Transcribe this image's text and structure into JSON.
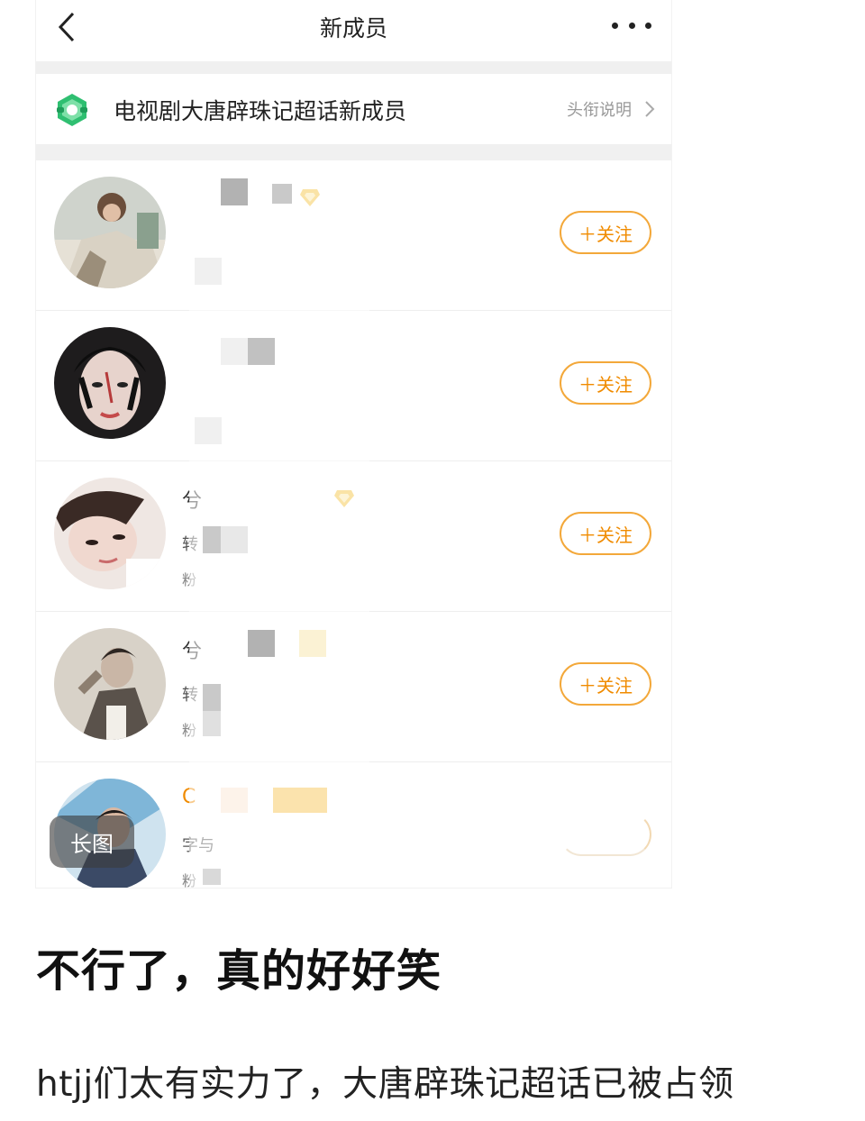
{
  "nav": {
    "title": "新成员"
  },
  "topic": {
    "name": "电视剧大唐辟珠记超话新成员",
    "link_label": "头衔说明"
  },
  "members": [
    {
      "name": "",
      "line1": "",
      "line2": "",
      "follow_label": "＋关注"
    },
    {
      "name": "",
      "line1": "",
      "line2": "",
      "follow_label": "＋关注"
    },
    {
      "name": "兮",
      "line1": "转",
      "line2": "粉",
      "follow_label": "＋关注"
    },
    {
      "name": "兮",
      "line1": "转",
      "line2": "粉",
      "follow_label": "＋关注"
    },
    {
      "name": "C",
      "line1": "字与",
      "line2": "粉",
      "follow_label": ""
    }
  ],
  "long_image_tag": "长图",
  "post": {
    "caption": "不行了，真的好好笑",
    "body": "htjj们太有实力了，大唐辟珠记超话已被占领"
  },
  "colors": {
    "follow_accent": "#f08b00",
    "badge_gold": "#f4c23a",
    "topic_icon_green": "#2fbf71"
  }
}
